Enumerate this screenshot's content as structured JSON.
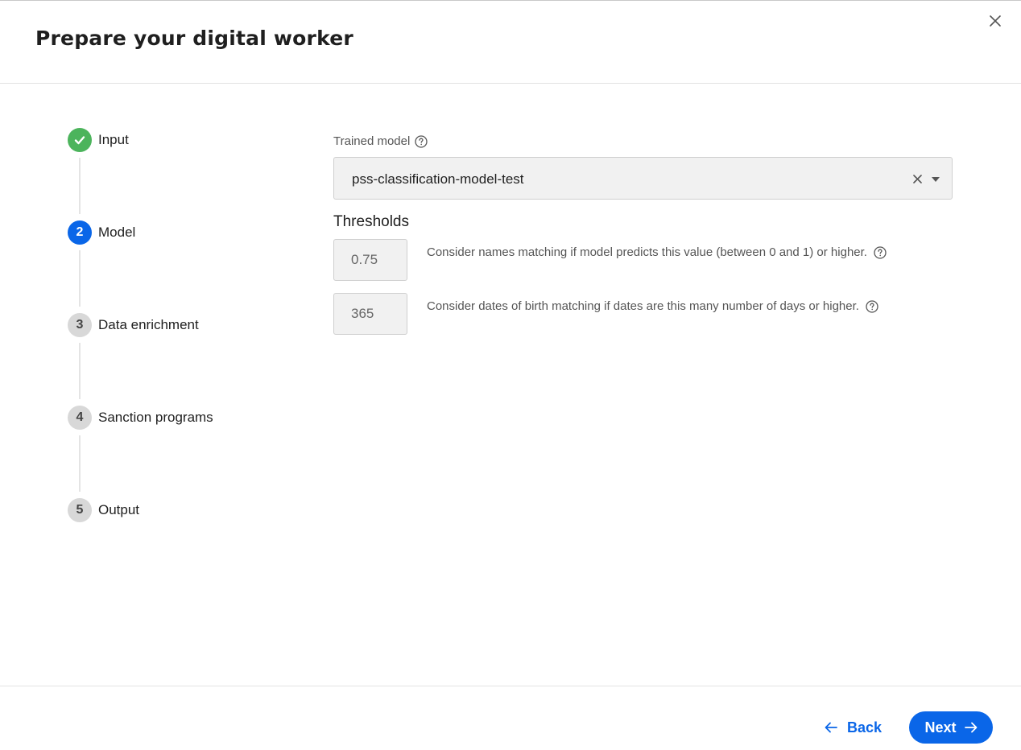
{
  "dialog": {
    "title": "Prepare your digital worker"
  },
  "steps": [
    {
      "number": "",
      "label": "Input",
      "state": "completed"
    },
    {
      "number": "2",
      "label": "Model",
      "state": "active"
    },
    {
      "number": "3",
      "label": "Data enrichment",
      "state": "pending"
    },
    {
      "number": "4",
      "label": "Sanction programs",
      "state": "pending"
    },
    {
      "number": "5",
      "label": "Output",
      "state": "pending"
    }
  ],
  "model": {
    "label": "Trained model",
    "selected": "pss-classification-model-test"
  },
  "thresholds": {
    "title": "Thresholds",
    "name_match": {
      "value": "0.75",
      "description": "Consider names matching if model predicts this value (between 0 and 1) or higher."
    },
    "dob_match": {
      "value": "365",
      "description": "Consider dates of birth matching if dates are this many number of days or higher."
    }
  },
  "footer": {
    "back_label": "Back",
    "next_label": "Next"
  },
  "colors": {
    "accent": "#0a66e8",
    "success": "#4cb45c",
    "pending": "#d8d8d8"
  }
}
